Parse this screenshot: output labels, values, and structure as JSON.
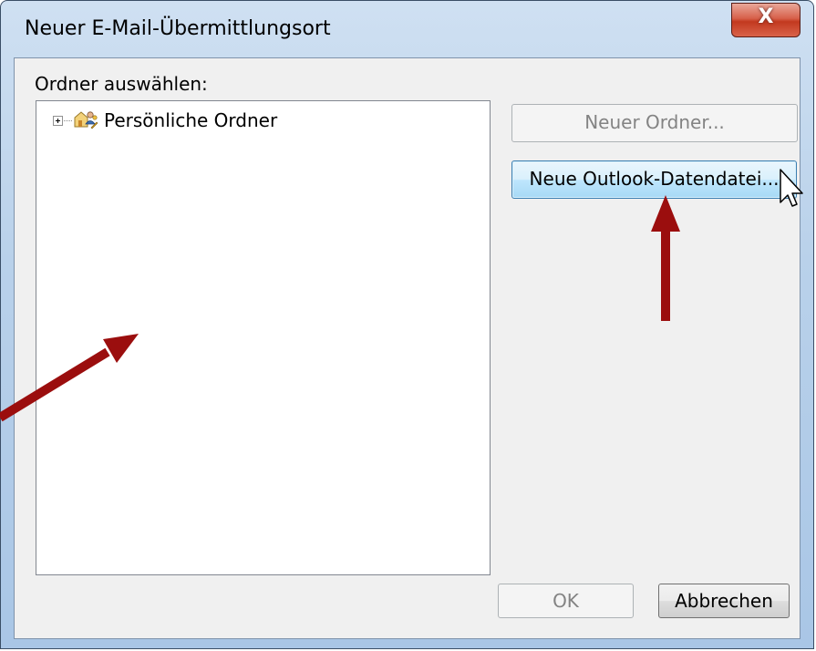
{
  "window": {
    "title": "Neuer E-Mail-Übermittlungsort",
    "close_label": "X"
  },
  "dialog": {
    "folder_label": "Ordner auswählen:",
    "tree": {
      "items": [
        {
          "label": "Persönliche Ordner",
          "icon": "personal-folders-icon",
          "expanded": false
        }
      ]
    },
    "buttons": {
      "new_folder": "Neuer Ordner...",
      "new_datafile": "Neue Outlook-Datendatei...",
      "ok": "OK",
      "cancel": "Abbrechen"
    }
  },
  "annotations": {
    "arrow_color": "#9b0e0e"
  }
}
